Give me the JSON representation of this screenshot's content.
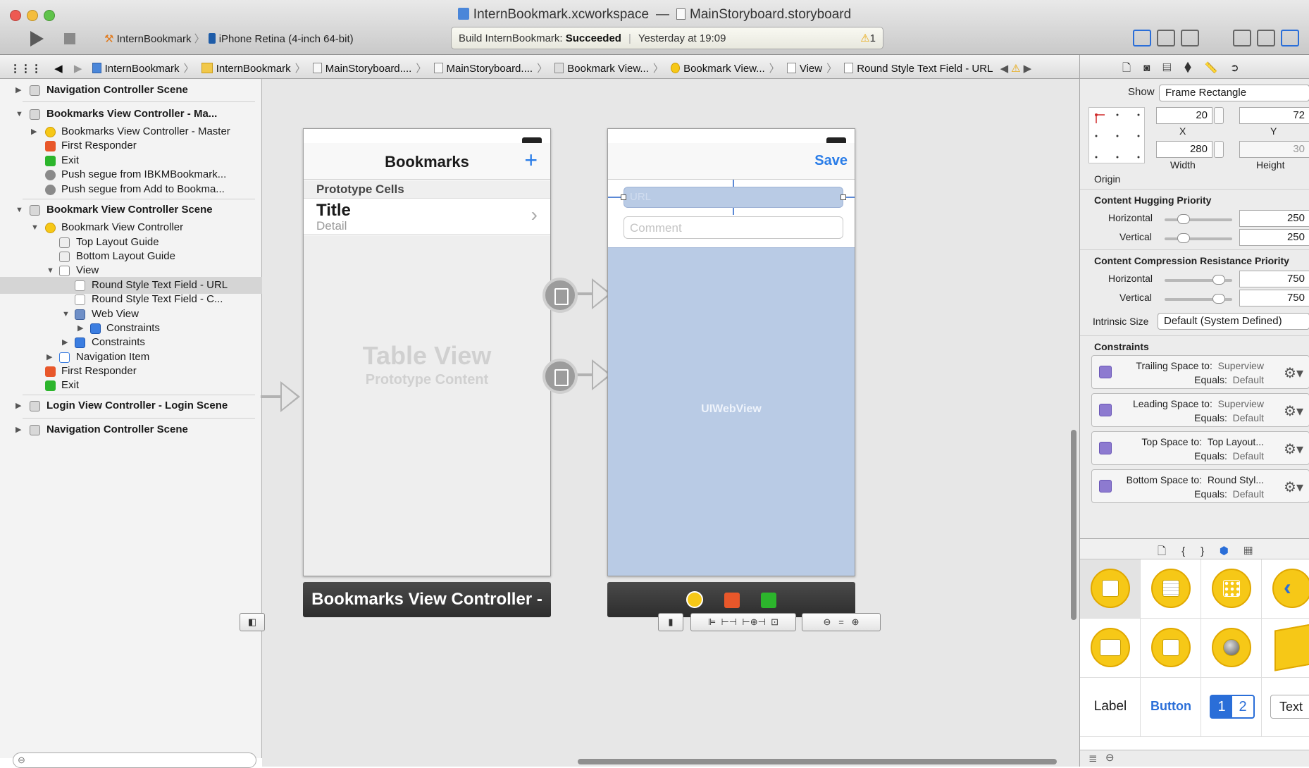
{
  "window": {
    "title_workspace": "InternBookmark.xcworkspace",
    "title_separator": "—",
    "title_file": "MainStoryboard.storyboard"
  },
  "toolbar": {
    "scheme": "InternBookmark",
    "device": "iPhone Retina (4-inch 64-bit)",
    "activity_prefix": "Build InternBookmark: ",
    "activity_status": "Succeeded",
    "activity_time": "Yesterday at 19:09",
    "warning_count": "1"
  },
  "jumpbar": {
    "crumbs": [
      "InternBookmark",
      "InternBookmark",
      "MainStoryboard....",
      "MainStoryboard....",
      "Bookmark View...",
      "Bookmark View...",
      "View",
      "Round Style Text Field - URL"
    ]
  },
  "navigator": {
    "rows": [
      {
        "label": "Navigation Controller Scene"
      },
      {
        "label": "Bookmarks View Controller - Ma..."
      },
      {
        "label": "Bookmarks View Controller - Master"
      },
      {
        "label": "First Responder"
      },
      {
        "label": "Exit"
      },
      {
        "label": "Push segue from IBKMBookmark..."
      },
      {
        "label": "Push segue from Add to Bookma..."
      },
      {
        "label": "Bookmark View Controller Scene"
      },
      {
        "label": "Bookmark View Controller"
      },
      {
        "label": "Top Layout Guide"
      },
      {
        "label": "Bottom Layout Guide"
      },
      {
        "label": "View"
      },
      {
        "label": "Round Style Text Field - URL"
      },
      {
        "label": "Round Style Text Field - C..."
      },
      {
        "label": "Web View"
      },
      {
        "label": "Constraints"
      },
      {
        "label": "Constraints"
      },
      {
        "label": "Navigation Item"
      },
      {
        "label": "First Responder"
      },
      {
        "label": "Exit"
      },
      {
        "label": "Login View Controller - Login Scene"
      },
      {
        "label": "Navigation Controller Scene"
      }
    ]
  },
  "canvas": {
    "bookmarks_scene": {
      "nav_title": "Bookmarks",
      "add_symbol": "+",
      "section_header": "Prototype Cells",
      "cell_title": "Title",
      "cell_detail": "Detail",
      "cell_chevron": "›",
      "placeholder_title": "Table View",
      "placeholder_sub": "Prototype Content",
      "dock_label": "Bookmarks View Controller -"
    },
    "bookmark_scene": {
      "save_label": "Save",
      "url_placeholder": "URL",
      "comment_placeholder": "Comment",
      "webview_label": "UIWebView"
    }
  },
  "inspector": {
    "show_label": "Show",
    "show_value": "Frame Rectangle",
    "x_value": "20",
    "y_value": "72",
    "x_label": "X",
    "y_label": "Y",
    "width_value": "280",
    "height_value": "30",
    "width_label": "Width",
    "height_label": "Height",
    "origin_label": "Origin",
    "hugging_title": "Content Hugging Priority",
    "horizontal_label": "Horizontal",
    "vertical_label": "Vertical",
    "hugging_h": "250",
    "hugging_v": "250",
    "resistance_title": "Content Compression Resistance Priority",
    "resistance_h": "750",
    "resistance_v": "750",
    "intrinsic_label": "Intrinsic Size",
    "intrinsic_value": "Default (System Defined)",
    "constraints_title": "Constraints",
    "constraints": [
      {
        "name": "Trailing Space to:",
        "target": "Superview",
        "equals": "Equals:",
        "value": "Default"
      },
      {
        "name": "Leading Space to:",
        "target": "Superview",
        "equals": "Equals:",
        "value": "Default"
      },
      {
        "name": "Top Space to:",
        "target": "Top Layout...",
        "equals": "Equals:",
        "value": "Default"
      },
      {
        "name": "Bottom Space to:",
        "target": "Round Styl...",
        "equals": "Equals:",
        "value": "Default"
      }
    ],
    "library": {
      "label_item": "Label",
      "button_item": "Button",
      "seg_1": "1",
      "seg_2": "2",
      "text_item": "Text"
    }
  },
  "colors": {
    "accent": "#2a6ed8",
    "object_yellow": "#f6c817",
    "webview_fill": "#b9cbe5",
    "selection": "#d5d5d5"
  }
}
